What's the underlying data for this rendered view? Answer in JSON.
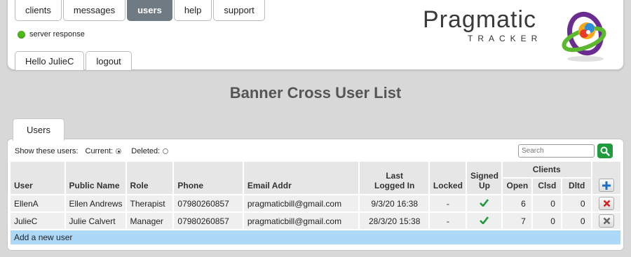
{
  "nav": {
    "tabs": [
      "clients",
      "messages",
      "users",
      "help",
      "support"
    ],
    "active": "users"
  },
  "status": {
    "server_label": "server response",
    "color": "#4cbb17"
  },
  "user_tabs": {
    "greeting": "Hello JulieC",
    "logout": "logout"
  },
  "logo": {
    "word": "Pragmatic",
    "sub": "TRACKER"
  },
  "page_title": "Banner Cross User List",
  "panel": {
    "tab": "Users",
    "filter_label": "Show these users:",
    "current_label": "Current:",
    "deleted_label": "Deleted:",
    "current_selected": true,
    "search_placeholder": "Search"
  },
  "table": {
    "headers": {
      "user": "User",
      "public_name": "Public Name",
      "role": "Role",
      "phone": "Phone",
      "email": "Email Addr",
      "last_logged_line1": "Last",
      "last_logged_line2": "Logged In",
      "locked": "Locked",
      "signed_line1": "Signed",
      "signed_line2": "Up",
      "clients": "Clients",
      "open": "Open",
      "clsd": "Clsd",
      "dltd": "Dltd"
    },
    "rows": [
      {
        "user": "EllenA",
        "public_name": "Ellen Andrews",
        "role": "Therapist",
        "phone": "07980260857",
        "email": "pragmaticbill@gmail.com",
        "last_logged": "9/3/20 16:38",
        "locked": "-",
        "signed_up": true,
        "open": "6",
        "clsd": "0",
        "dltd": "0",
        "delete_color": "#d42020"
      },
      {
        "user": "JulieC",
        "public_name": "Julie Calvert",
        "role": "Manager",
        "phone": "07980260857",
        "email": "pragmaticbill@gmail.com",
        "last_logged": "28/3/20 15:38",
        "locked": "-",
        "signed_up": true,
        "open": "7",
        "clsd": "0",
        "dltd": "0",
        "delete_color": "#666666"
      }
    ],
    "add_row_label": "Add a new user"
  },
  "colors": {
    "accent_add": "#1a6fc4",
    "check": "#1f9a3c",
    "search_button": "#1f9a3c",
    "add_row_bg": "#aed8f8",
    "active_tab": "#6f7a83"
  }
}
